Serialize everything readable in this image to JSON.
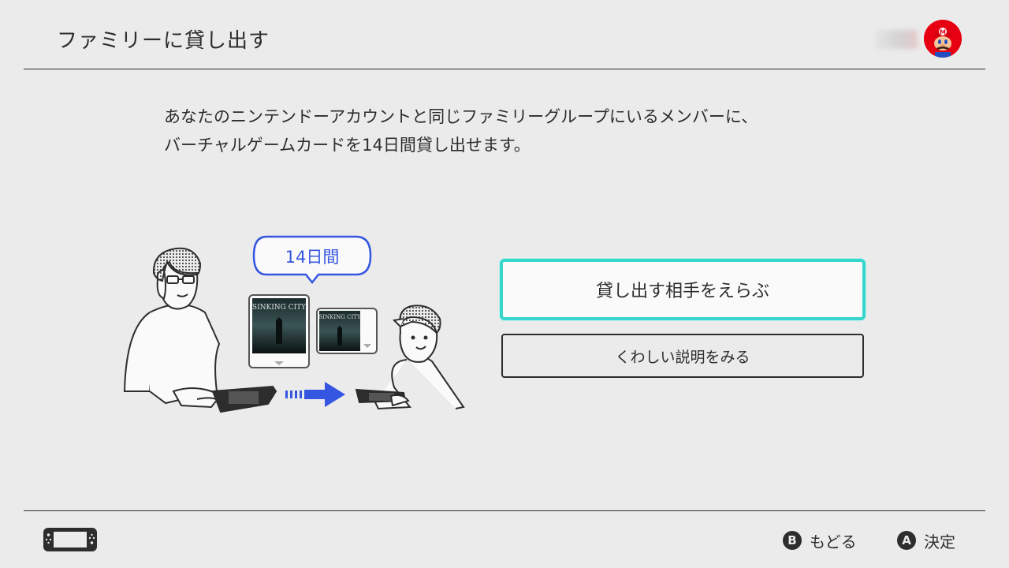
{
  "header": {
    "title": "ファミリーに貸し出す"
  },
  "description": {
    "line1": "あなたのニンテンドーアカウントと同じファミリーグループにいるメンバーに、",
    "line2": "バーチャルゲームカードを14日間貸し出せます。"
  },
  "illustration": {
    "bubble_text": "14日間"
  },
  "actions": {
    "select_recipient_label": "貸し出す相手をえらぶ",
    "details_label": "くわしい説明をみる"
  },
  "footer": {
    "back_button_glyph": "B",
    "back_label": "もどる",
    "confirm_button_glyph": "A",
    "confirm_label": "決定"
  },
  "colors": {
    "background": "#ebebeb",
    "selection_highlight": "#37d6cd",
    "arrow_accent": "#3556e0",
    "avatar_red": "#e60012"
  },
  "icons": {
    "avatar": "mario-avatar-icon",
    "console": "switch-handheld-icon"
  }
}
